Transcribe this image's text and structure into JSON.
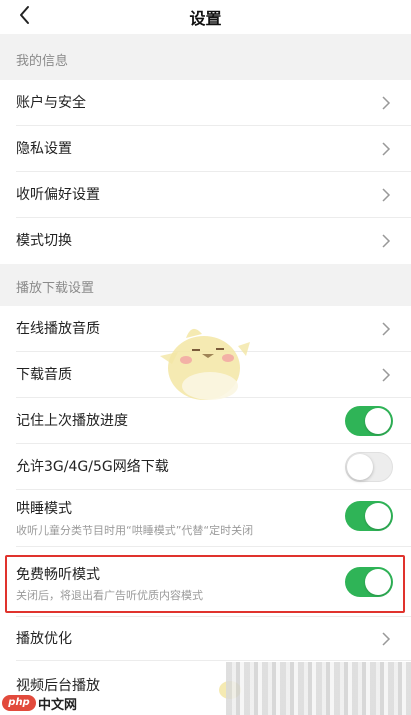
{
  "nav": {
    "title": "设置",
    "back_icon": "chevron-left-icon"
  },
  "sections": {
    "my_info": "我的信息",
    "playback_download": "播放下载设置"
  },
  "rows": {
    "account_security": "账户与安全",
    "privacy": "隐私设置",
    "listening_pref": "收听偏好设置",
    "mode_switch": "模式切换",
    "online_quality": "在线播放音质",
    "download_quality": "下载音质",
    "remember_progress": "记住上次播放进度",
    "allow_mobile_download": "允许3G/4G/5G网络下载",
    "sleep_mode": "哄睡模式",
    "sleep_mode_desc": "收听儿童分类节目时用“哄睡模式”代替“定时关闭",
    "free_listen": "免费畅听模式",
    "free_listen_desc": "关闭后，将退出看广告听优质内容模式",
    "playback_opt": "播放优化",
    "video_background": "视频后台播放"
  },
  "toggles": {
    "remember_progress": true,
    "allow_mobile_download": false,
    "sleep_mode": true,
    "free_listen": true
  },
  "colors": {
    "toggle_on": "#2fb457",
    "highlight": "#e0332d"
  },
  "watermark": {
    "badge": "php",
    "text": "中文网"
  }
}
